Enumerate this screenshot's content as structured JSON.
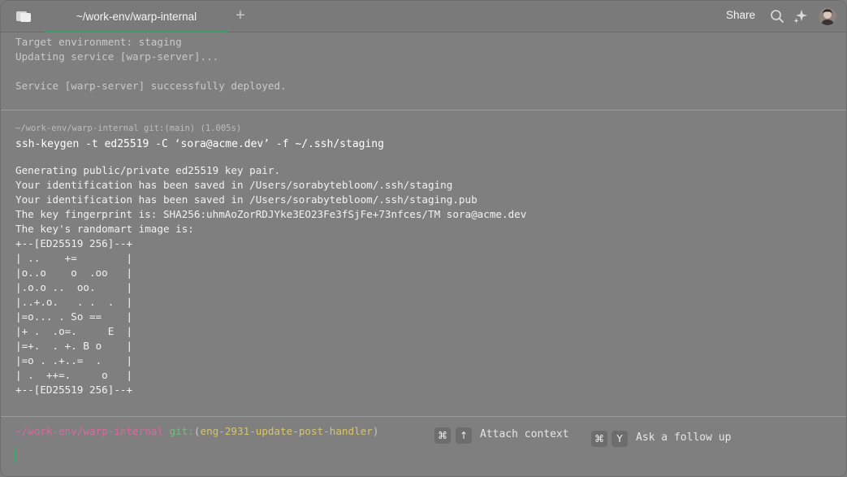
{
  "titlebar": {
    "tab_title": "~/work-env/warp-internal",
    "new_tab_label": "+",
    "share_label": "Share",
    "icons": {
      "sidebar": "sidebar-toggle-icon",
      "search": "search-icon",
      "ai": "sparkle-icon",
      "avatar": "user-avatar"
    },
    "accent_color": "#3f9d6a"
  },
  "previous_block": {
    "lines": [
      "Target environment: staging",
      "Updating service [warp-server]...",
      "",
      "Service [warp-server] successfully deployed."
    ]
  },
  "current_block": {
    "meta": "~/work-env/warp-internal git:(main) (1.005s)",
    "command": "ssh-keygen -t ed25519 -C ‘sora@acme.dev’ -f ~/.ssh/staging",
    "output": [
      "Generating public/private ed25519 key pair.",
      "Your identification has been saved in /Users/sorabytebloom/.ssh/staging",
      "Your identification has been saved in /Users/sorabytebloom/.ssh/staging.pub",
      "The key fingerprint is: SHA256:uhmAoZorRDJYke3EO23Fe3fSjFe+73nfces/TM sora@acme.dev",
      "The key's randomart image is:",
      "+--[ED25519 256]--+",
      "| ..    +=        |",
      "|o..o    o  .oo   |",
      "|.o.o ..  oo.     |",
      "|..+.o.   . .  .  |",
      "|=o... . So ==    |",
      "|+ .  .o=.     E  |",
      "|=+.  . +. B o    |",
      "|=o . .+..=  .    |",
      "| .  ++=.     o   |",
      "+--[ED25519 256]--+"
    ]
  },
  "prompt": {
    "path": "~/work-env/warp-internal",
    "git_label": "git:",
    "paren_open": "(",
    "branch": "eng-2931-update-post-handler",
    "paren_close": ")",
    "path_color": "#d76a9c",
    "git_color": "#78b884",
    "branch_color": "#d8c46a",
    "attach_keys": [
      "⌘",
      "↑"
    ],
    "attach_label": "Attach context",
    "followup_keys": [
      "⌘",
      "Y"
    ],
    "followup_label": "Ask a follow up"
  }
}
